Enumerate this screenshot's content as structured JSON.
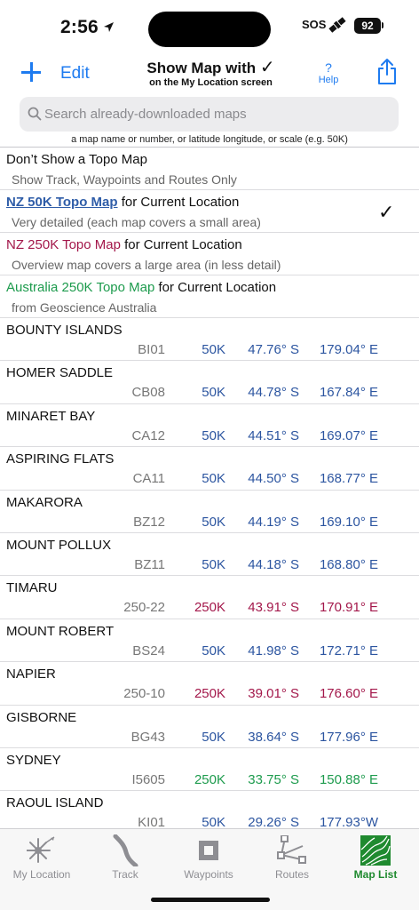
{
  "status": {
    "time": "2:56",
    "sos": "SOS",
    "battery": "92"
  },
  "nav": {
    "edit": "Edit",
    "title": "Show Map with",
    "title_check": "✓",
    "subtitle": "on the My Location screen",
    "help_q": "?",
    "help_label": "Help"
  },
  "search": {
    "placeholder": "Search already-downloaded maps",
    "hint": "a map name or number, or latitude longitude, or scale (e.g. 50K)"
  },
  "options": [
    {
      "title": "Don’t Show a Topo Map",
      "suffix": "",
      "subtitle": "Show Track, Waypoints and Routes Only"
    },
    {
      "title": "NZ 50K Topo Map",
      "suffix": " for Current Location",
      "subtitle": "Very detailed (each map covers a small area)",
      "check": "✓"
    },
    {
      "title": "NZ 250K Topo Map",
      "suffix": " for Current Location",
      "subtitle": "Overview map covers a large area (in less detail)"
    },
    {
      "title": "Australia 250K Topo Map",
      "suffix": " for Current Location",
      "subtitle": "from Geoscience Australia"
    }
  ],
  "maps": [
    {
      "name": "BOUNTY ISLANDS",
      "code": "BI01",
      "scale": "50K",
      "lat": "47.76° S",
      "lon": "179.04° E",
      "color": "blue"
    },
    {
      "name": "HOMER SADDLE",
      "code": "CB08",
      "scale": "50K",
      "lat": "44.78° S",
      "lon": "167.84° E",
      "color": "blue"
    },
    {
      "name": "MINARET BAY",
      "code": "CA12",
      "scale": "50K",
      "lat": "44.51° S",
      "lon": "169.07° E",
      "color": "blue"
    },
    {
      "name": "ASPIRING FLATS",
      "code": "CA11",
      "scale": "50K",
      "lat": "44.50° S",
      "lon": "168.77° E",
      "color": "blue"
    },
    {
      "name": "MAKARORA",
      "code": "BZ12",
      "scale": "50K",
      "lat": "44.19° S",
      "lon": "169.10° E",
      "color": "blue"
    },
    {
      "name": "MOUNT POLLUX",
      "code": "BZ11",
      "scale": "50K",
      "lat": "44.18° S",
      "lon": "168.80° E",
      "color": "blue"
    },
    {
      "name": "TIMARU",
      "code": "250-22",
      "scale": "250K",
      "lat": "43.91° S",
      "lon": "170.91° E",
      "color": "red"
    },
    {
      "name": "MOUNT ROBERT",
      "code": "BS24",
      "scale": "50K",
      "lat": "41.98° S",
      "lon": "172.71° E",
      "color": "blue"
    },
    {
      "name": "NAPIER",
      "code": "250-10",
      "scale": "250K",
      "lat": "39.01° S",
      "lon": "176.60° E",
      "color": "red"
    },
    {
      "name": "GISBORNE",
      "code": "BG43",
      "scale": "50K",
      "lat": "38.64° S",
      "lon": "177.96° E",
      "color": "blue"
    },
    {
      "name": "SYDNEY",
      "code": "I5605",
      "scale": "250K",
      "lat": "33.75° S",
      "lon": "150.88° E",
      "color": "green"
    },
    {
      "name": "RAOUL ISLAND",
      "code": "KI01",
      "scale": "50K",
      "lat": "29.26° S",
      "lon": "177.93°W",
      "color": "blue"
    }
  ],
  "tabs": [
    {
      "label": "My Location",
      "icon": "compass-rose-icon"
    },
    {
      "label": "Track",
      "icon": "track-icon"
    },
    {
      "label": "Waypoints",
      "icon": "waypoints-icon"
    },
    {
      "label": "Routes",
      "icon": "routes-icon"
    },
    {
      "label": "Map List",
      "icon": "map-list-icon",
      "active": true
    }
  ],
  "colors": {
    "accent": "#1e7bf0",
    "nz50k": "#2c55a0",
    "nz250k": "#a3174a",
    "aus250k": "#1d9b4d",
    "active_tab": "#1f8a2f"
  }
}
